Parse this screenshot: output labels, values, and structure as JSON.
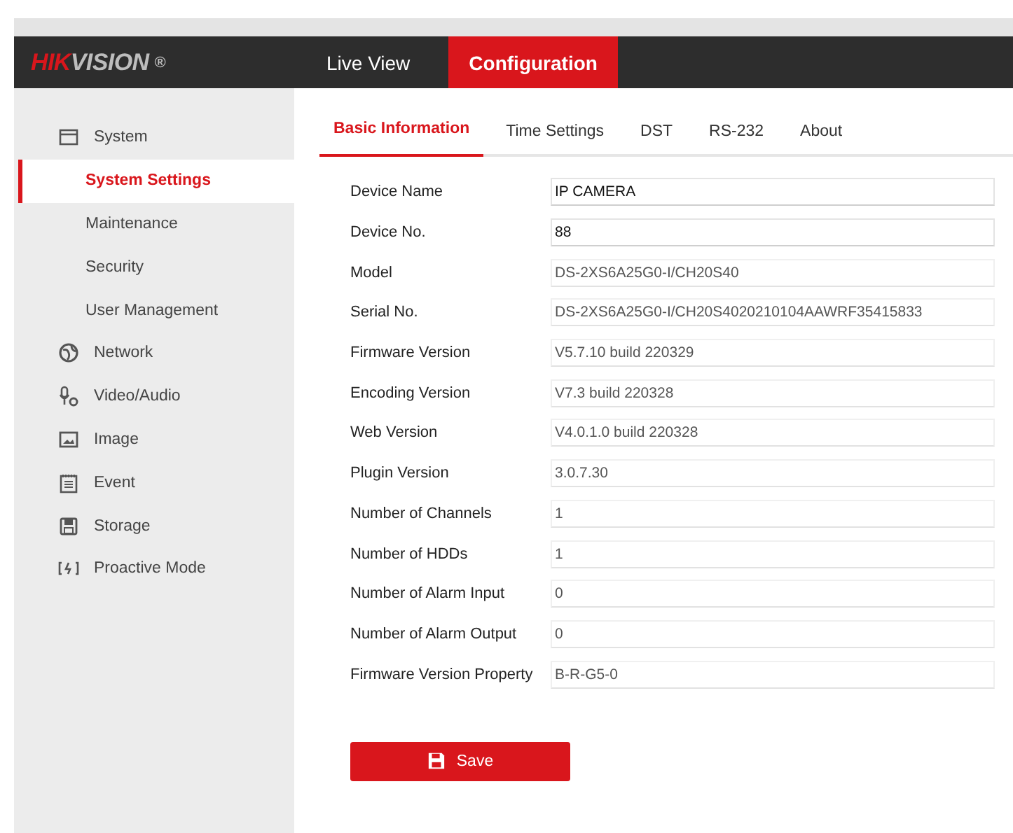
{
  "header": {
    "logo": [
      "HIK",
      "VISION"
    ],
    "logo_mark": "®",
    "nav": [
      {
        "label": "Live View",
        "selected": false
      },
      {
        "label": "Configuration",
        "selected": true
      }
    ]
  },
  "sidebar": {
    "groups": [
      {
        "label": "System",
        "selected": false,
        "children": [
          {
            "label": "System Settings",
            "selected": true
          },
          {
            "label": "Maintenance",
            "selected": false
          },
          {
            "label": "Security",
            "selected": false
          },
          {
            "label": "User Management",
            "selected": false
          }
        ]
      },
      {
        "label": "Network",
        "selected": false
      },
      {
        "label": "Video/Audio",
        "selected": false
      },
      {
        "label": "Image",
        "selected": false
      },
      {
        "label": "Event",
        "selected": false
      },
      {
        "label": "Storage",
        "selected": false
      },
      {
        "label": "Proactive Mode",
        "selected": false
      }
    ]
  },
  "tabs": [
    {
      "label": "Basic Information",
      "selected": true
    },
    {
      "label": "Time Settings",
      "selected": false
    },
    {
      "label": "DST",
      "selected": false
    },
    {
      "label": "RS-232",
      "selected": false
    },
    {
      "label": "About",
      "selected": false
    }
  ],
  "fields": [
    {
      "label": "Device Name",
      "value": "IP CAMERA",
      "kind": "editable"
    },
    {
      "label": "Device No.",
      "value": "88",
      "kind": "editable"
    },
    {
      "label": "Model",
      "value": "DS-2XS6A25G0-I/CH20S40",
      "kind": "readonly"
    },
    {
      "label": "Serial No.",
      "value": "DS-2XS6A25G0-I/CH20S4020210104AAWRF35415833",
      "kind": "readonly"
    },
    {
      "label": "Firmware Version",
      "value": "V5.7.10 build 220329",
      "kind": "readonly"
    },
    {
      "label": "Encoding Version",
      "value": "V7.3 build 220328",
      "kind": "readonly"
    },
    {
      "label": "Web Version",
      "value": "V4.0.1.0 build 220328",
      "kind": "readonly"
    },
    {
      "label": "Plugin Version",
      "value": "3.0.7.30",
      "kind": "readonly"
    },
    {
      "label": "Number of Channels",
      "value": "1",
      "kind": "readonly"
    },
    {
      "label": "Number of HDDs",
      "value": "1",
      "kind": "readonly"
    },
    {
      "label": "Number of Alarm Input",
      "value": "0",
      "kind": "readonly"
    },
    {
      "label": "Number of Alarm Output",
      "value": "0",
      "kind": "readonly"
    },
    {
      "label": "Firmware Version Property",
      "value": "B-R-G5-0",
      "kind": "readonly"
    }
  ],
  "save_button": {
    "label": "Save"
  }
}
